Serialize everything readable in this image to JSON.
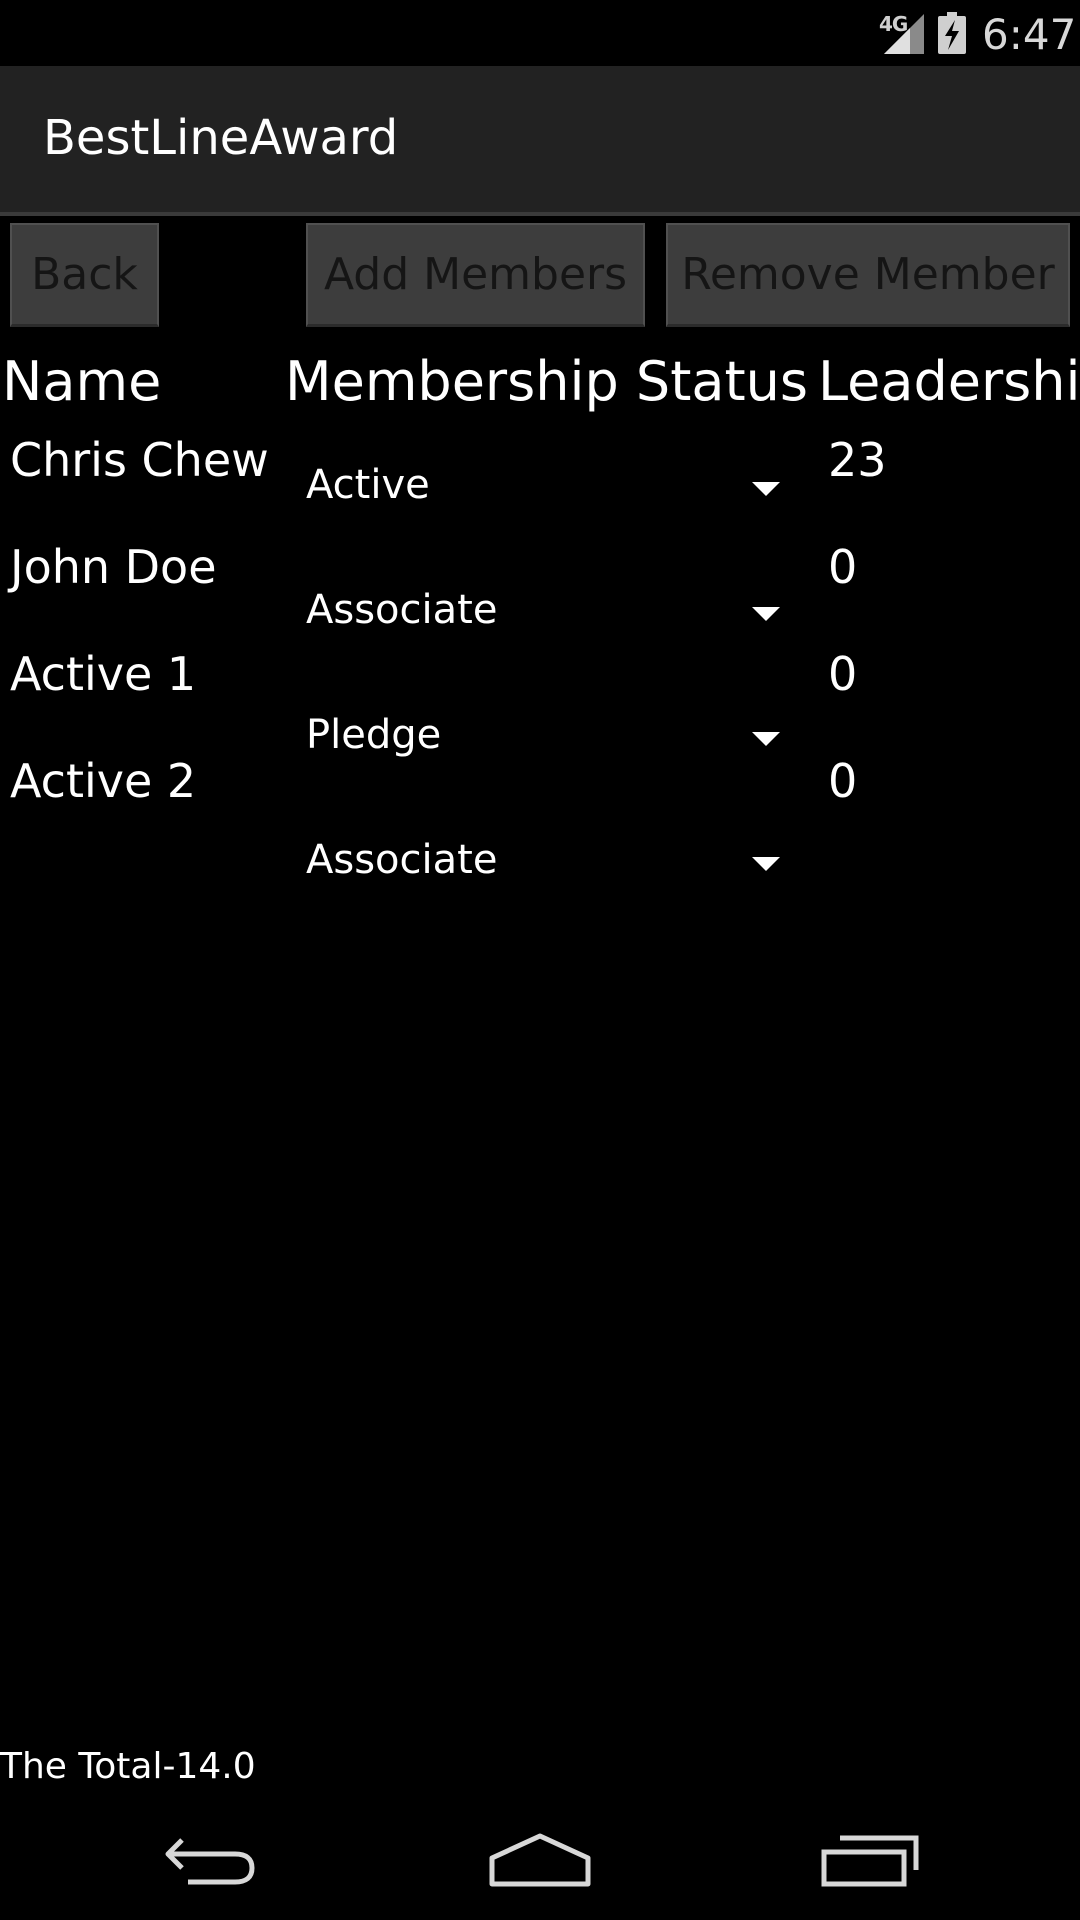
{
  "status_bar": {
    "network": "4G",
    "time": "6:47"
  },
  "app_bar": {
    "title": "BestLineAward"
  },
  "buttons": {
    "back": "Back",
    "add_members": "Add Members",
    "remove_member": "Remove Member"
  },
  "table": {
    "headers": {
      "name": "Name",
      "status": "Membership Status",
      "leadership": "Leadership"
    },
    "rows": [
      {
        "name": "Chris Chew",
        "leadership": "23"
      },
      {
        "name": "John Doe",
        "leadership": "0"
      },
      {
        "name": "Active 1",
        "leadership": "0"
      },
      {
        "name": "Active 2",
        "leadership": "0"
      }
    ],
    "status_spinners": [
      "Active",
      "Associate",
      "Pledge",
      "Associate"
    ]
  },
  "footer": {
    "total": "The Total-14.0"
  },
  "nav_bar": {
    "icons": [
      "back-icon",
      "home-icon",
      "recent-apps-icon"
    ]
  }
}
